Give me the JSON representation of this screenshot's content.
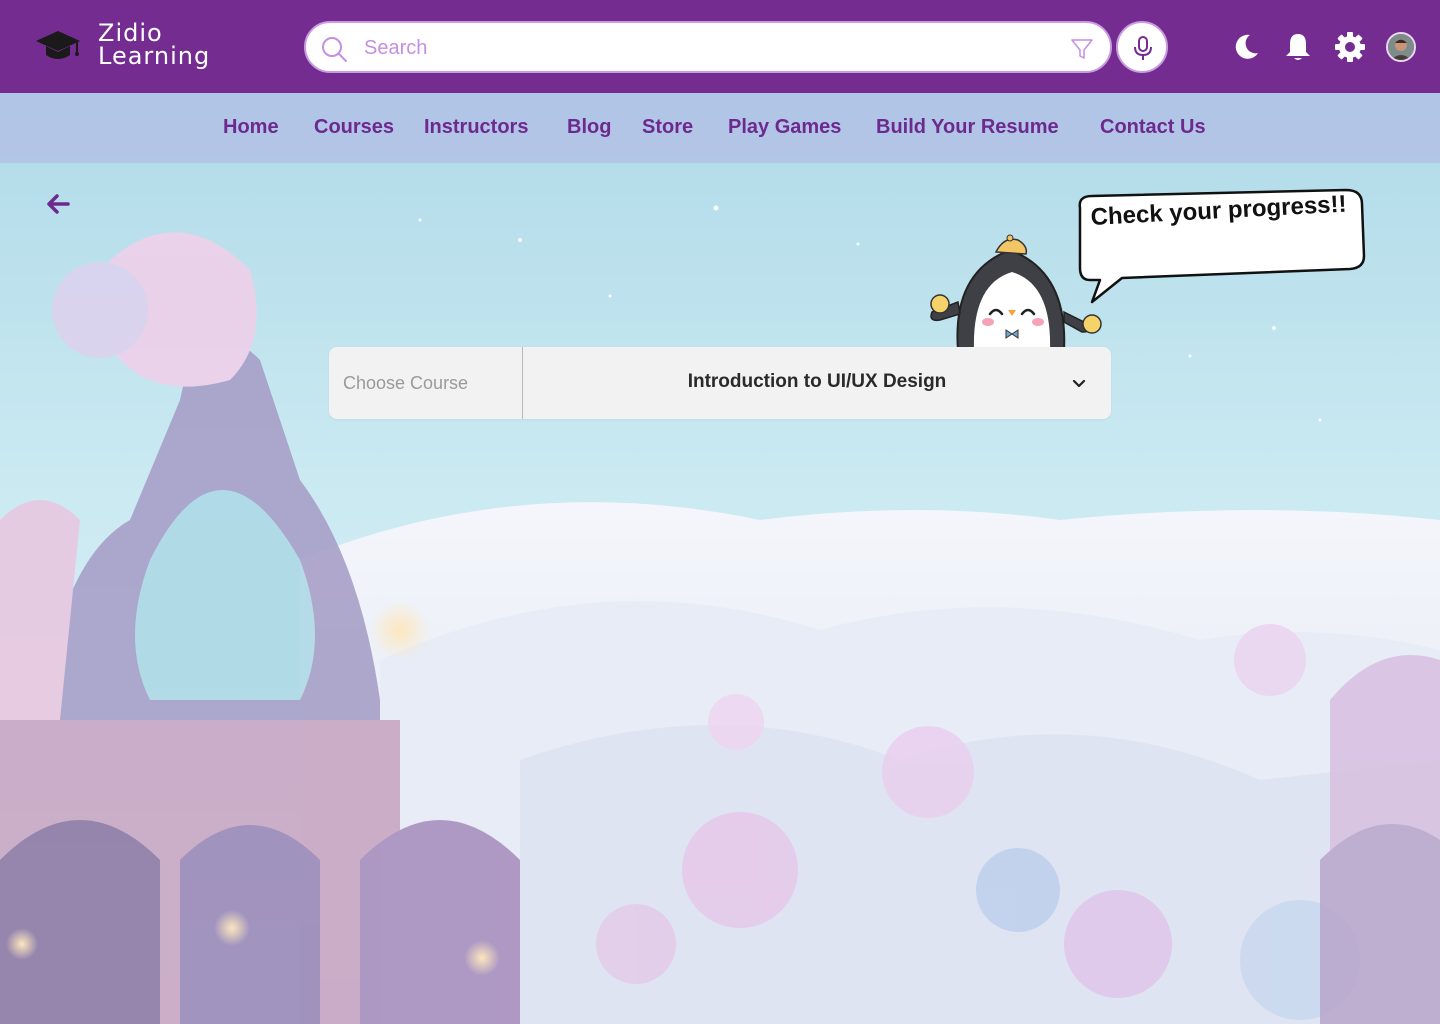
{
  "brand": {
    "line1": "Zidio",
    "line2": "Learning"
  },
  "search": {
    "placeholder": "Search"
  },
  "header_icons": [
    "search-icon",
    "filter-icon",
    "microphone-icon",
    "moon-icon",
    "bell-icon",
    "gear-icon",
    "avatar"
  ],
  "nav": {
    "items": [
      {
        "label": "Home"
      },
      {
        "label": "Courses"
      },
      {
        "label": "Instructors"
      },
      {
        "label": "Blog"
      },
      {
        "label": "Store"
      },
      {
        "label": "Play Games"
      },
      {
        "label": "Build Your Resume"
      },
      {
        "label": "Contact Us"
      }
    ]
  },
  "mascot": {
    "speech": "Check your progress!!"
  },
  "course_select": {
    "label": "Choose Course",
    "selected": "Introduction to UI/UX Design"
  },
  "colors": {
    "header_bg": "#742c91",
    "nav_text": "#6d2a8e",
    "accent": "#c99be0"
  }
}
